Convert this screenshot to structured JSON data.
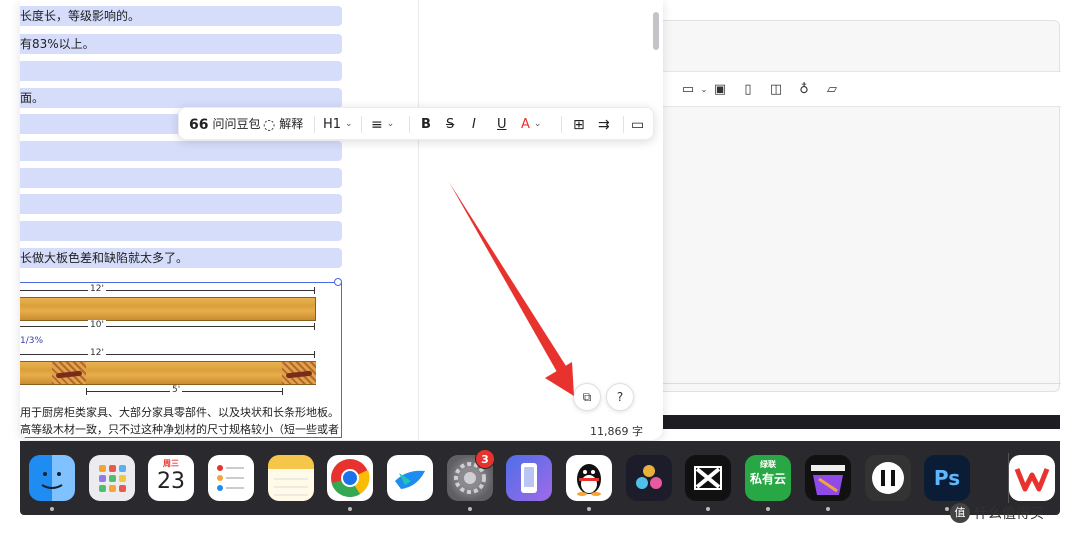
{
  "document": {
    "lines": [
      "长度长，等级影响的。",
      "有83%以上。",
      "",
      "面。",
      "",
      "",
      "",
      "",
      "",
      "长做大板色差和缺陷就太多了。"
    ],
    "diagram": {
      "top_length": "12'",
      "middle_length": "10'",
      "fraction": "1/3%",
      "bottom_length": "12'",
      "clear_length": "5'"
    },
    "paragraph_lines": [
      "用于厨房柜类家具、大部分家具零部件、以及块状和长条形地板。",
      "高等级木材一致，只不过这种净划材的尺寸规格较小（短一些或者"
    ],
    "word_count": "11,869 字"
  },
  "floating_toolbar": {
    "ask_label": "问问豆包",
    "explain_label": "解释",
    "heading_label": "H1",
    "bold": "B",
    "strike": "S",
    "italic": "I",
    "underline": "U",
    "font_color": "A"
  },
  "dock": {
    "calendar_month": "周三",
    "calendar_day": "23",
    "settings_badge": "3",
    "yunyun_top": "绿联",
    "yunyun_label": "私有云",
    "ps_label": "Ps"
  },
  "watermark": {
    "icon": "值",
    "text": "什么值得买"
  },
  "colors": {
    "highlight": "#d5ddfb",
    "accent_blue": "#4a66e0",
    "arrow_red": "#e8322d",
    "dock_bg": "#2a2a2e"
  }
}
